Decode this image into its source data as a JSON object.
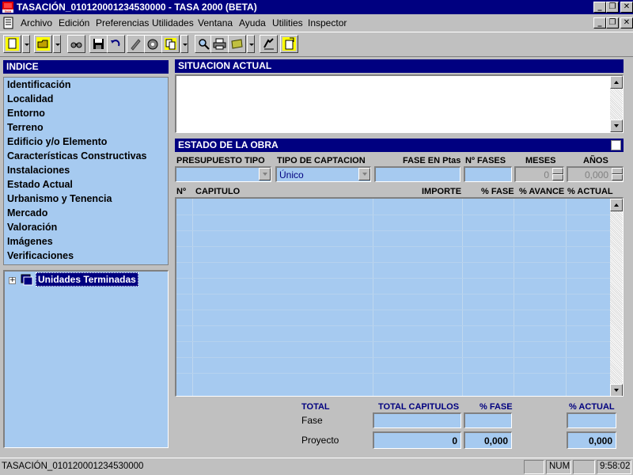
{
  "window": {
    "title": "TASACIÓN_010120001234530000 - TASA 2000 (BETA)",
    "app_icon": "tasa-logo-icon",
    "app_icon_caption": "tasa"
  },
  "menu": [
    "Archivo",
    "Edición",
    "Preferencias",
    "Utilidades",
    "Ventana",
    "Ayuda",
    "Utilities",
    "Inspector"
  ],
  "toolbar": [
    "new-document-icon",
    "open-folder-icon",
    "binoculars-icon",
    "save-icon",
    "undo-icon",
    "edit-pencil-icon",
    "calculator-icon",
    "copy-paste-icon",
    "search-magnifier-icon",
    "printer-icon",
    "notes-icon",
    "help-pointer-icon",
    "exit-door-icon"
  ],
  "indice": {
    "title": "INDICE",
    "items": [
      "Identificación",
      "Localidad",
      "Entorno",
      "Terreno",
      "Edificio y/o Elemento",
      "Características Constructivas",
      "Instalaciones",
      "Estado Actual",
      "Urbanismo y Tenencia",
      "Mercado",
      "Valoración",
      "Imágenes",
      "Verificaciones"
    ]
  },
  "tree": {
    "expander": "+",
    "node_label": "Unidades Terminadas"
  },
  "situacion": {
    "title": "SITUACION ACTUAL",
    "text": ""
  },
  "estado": {
    "title": "ESTADO DE LA OBRA",
    "labels": {
      "presupuesto": "PRESUPUESTO TIPO",
      "captacion": "TIPO DE CAPTACION",
      "fase": "FASE EN Ptas",
      "nfases": "Nº FASES",
      "meses": "MESES",
      "anos": "AÑOS"
    },
    "values": {
      "presupuesto": "",
      "captacion": "Único",
      "fase": "",
      "nfases": "",
      "meses": "0",
      "anos": "0,000"
    }
  },
  "grid": {
    "columns": [
      "Nº",
      "CAPITULO",
      "IMPORTE",
      "% FASE",
      "% AVANCE",
      "% ACTUAL"
    ],
    "rows": []
  },
  "totals": {
    "header_total": "TOTAL",
    "header_capitulos": "TOTAL CAPITULOS",
    "header_fase": "% FASE",
    "header_actual": "% ACTUAL",
    "row_fase": "Fase",
    "row_proyecto": "Proyecto",
    "fase_capitulos": "",
    "fase_pct": "",
    "fase_actual": "",
    "proyecto_capitulos": "0",
    "proyecto_pct": "0,000",
    "proyecto_actual": "0,000"
  },
  "status": {
    "text": "TASACIÓN_010120001234530000",
    "num": "NUM",
    "time": "9:58:02"
  }
}
